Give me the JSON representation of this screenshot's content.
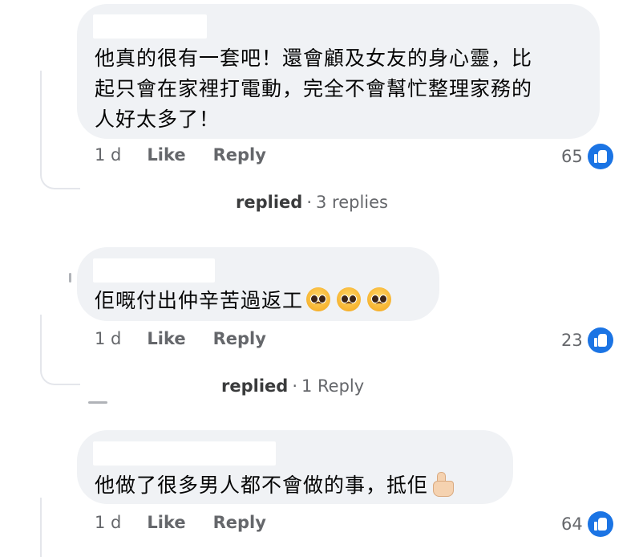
{
  "comments": [
    {
      "text": "他真的很有一套吧！還會顧及女友的身心靈，比起只會在家裡打電動，完全不會幫忙整理家務的人好太多了！",
      "lines": [
        "他真的很有一套吧！還會顧及女友的身心靈，比",
        "起只會在家裡打電動，完全不會幫忙整理家務的",
        "人好太多了！"
      ],
      "time": "1 d",
      "like_label": "Like",
      "reply_label": "Reply",
      "like_count": "65",
      "replies": {
        "replied": "replied",
        "count_text": "3 replies"
      }
    },
    {
      "text": "佢嘅付出仲辛苦過返工",
      "emojis": [
        "pleading-face-icon",
        "pleading-face-icon",
        "pleading-face-icon"
      ],
      "time": "1 d",
      "like_label": "Like",
      "reply_label": "Reply",
      "like_count": "23",
      "replies": {
        "replied": "replied",
        "count_text": "1 Reply"
      }
    },
    {
      "text": "他做了很多男人都不會做的事，抵佢",
      "emojis": [
        "thumbs-up-icon"
      ],
      "time": "1 d",
      "like_label": "Like",
      "reply_label": "Reply",
      "like_count": "64"
    }
  ],
  "replies_separator": "·",
  "colors": {
    "bubble": "#f0f2f5",
    "meta_text": "#65676b",
    "like_badge": "#1b74e4",
    "thread_line": "#e4e6eb"
  }
}
